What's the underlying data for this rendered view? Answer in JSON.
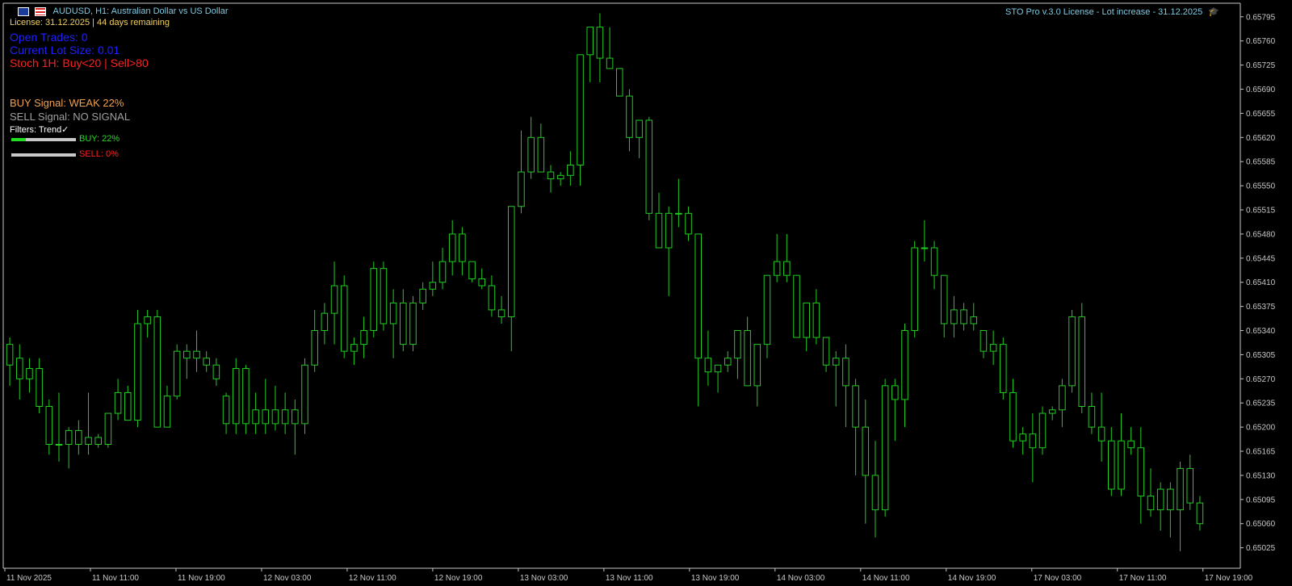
{
  "header": {
    "symbol_line": "AUDUSD, H1:  Australian Dollar vs US Dollar",
    "license_line": "License: 31.12.2025 | 44 days remaining",
    "right_title": "STO Pro v.3.0 License - Lot increase - 31.12.2025"
  },
  "panel": {
    "open_trades": "Open Trades: 0",
    "lot_size": "Current Lot Size: 0.01",
    "stoch": "Stoch 1H: Buy<20 | Sell>80",
    "buy_signal": "BUY Signal: WEAK 22%",
    "sell_signal": "SELL Signal: NO SIGNAL",
    "filters": "Filters: Trend✓",
    "buy_bar_label": "BUY: 22%",
    "sell_bar_label": "SELL: 0%",
    "buy_level": 0.22,
    "sell_level": 0.0
  },
  "colors": {
    "background": "#000000",
    "candle": "#22cc22",
    "axis": "#c8c8c8",
    "symbol_text": "#7fc8e0",
    "license_text": "#f0d060",
    "open_trades": "#2020ff",
    "stoch": "#ff2020",
    "buy_signal": "#f0a050",
    "sell_signal": "#a0a0a0",
    "buy_bar_label": "#22dd22",
    "sell_bar_label": "#ff2020"
  },
  "chart_data": {
    "type": "candlestick",
    "y_ticks": [
      "0.65795",
      "0.65760",
      "0.65725",
      "0.65690",
      "0.65655",
      "0.65620",
      "0.65585",
      "0.65550",
      "0.65515",
      "0.65480",
      "0.65445",
      "0.65410",
      "0.65375",
      "0.65340",
      "0.65305",
      "0.65270",
      "0.65235",
      "0.65200",
      "0.65165",
      "0.65130",
      "0.65095",
      "0.65060",
      "0.65025"
    ],
    "ylim": [
      0.65,
      0.6581
    ],
    "x_ticks": [
      "11 Nov 2025",
      "11 Nov 11:00",
      "11 Nov 19:00",
      "12 Nov 03:00",
      "12 Nov 11:00",
      "12 Nov 19:00",
      "13 Nov 03:00",
      "13 Nov 11:00",
      "13 Nov 19:00",
      "14 Nov 03:00",
      "14 Nov 11:00",
      "14 Nov 19:00",
      "17 Nov 03:00",
      "17 Nov 11:00",
      "17 Nov 19:00"
    ],
    "candles": [
      [
        0.6529,
        0.6533,
        0.6526,
        0.6532
      ],
      [
        0.653,
        0.6532,
        0.6524,
        0.6527
      ],
      [
        0.6527,
        0.653,
        0.6525,
        0.65285
      ],
      [
        0.65285,
        0.653,
        0.6522,
        0.6523
      ],
      [
        0.6523,
        0.6524,
        0.6516,
        0.65175
      ],
      [
        0.65175,
        0.6525,
        0.6515,
        0.65175
      ],
      [
        0.65175,
        0.652,
        0.6514,
        0.65195
      ],
      [
        0.65195,
        0.6521,
        0.6516,
        0.65175
      ],
      [
        0.65175,
        0.6525,
        0.6516,
        0.65185
      ],
      [
        0.65185,
        0.6519,
        0.6517,
        0.65175
      ],
      [
        0.65175,
        0.6522,
        0.6517,
        0.6522
      ],
      [
        0.6522,
        0.6527,
        0.6521,
        0.6525
      ],
      [
        0.6525,
        0.6526,
        0.6521,
        0.6521
      ],
      [
        0.6521,
        0.6537,
        0.652,
        0.6535
      ],
      [
        0.6535,
        0.6537,
        0.6533,
        0.6536
      ],
      [
        0.6536,
        0.6537,
        0.652,
        0.652
      ],
      [
        0.652,
        0.6526,
        0.652,
        0.65245
      ],
      [
        0.65245,
        0.6532,
        0.6524,
        0.6531
      ],
      [
        0.6531,
        0.6532,
        0.6527,
        0.653
      ],
      [
        0.653,
        0.6534,
        0.6528,
        0.6531
      ],
      [
        0.653,
        0.6531,
        0.6528,
        0.6529
      ],
      [
        0.6529,
        0.653,
        0.6526,
        0.6527
      ],
      [
        0.65245,
        0.6525,
        0.6519,
        0.65205
      ],
      [
        0.65205,
        0.653,
        0.6519,
        0.65285
      ],
      [
        0.65285,
        0.6529,
        0.6519,
        0.65205
      ],
      [
        0.65205,
        0.6525,
        0.6519,
        0.65225
      ],
      [
        0.65225,
        0.6527,
        0.6519,
        0.65205
      ],
      [
        0.65205,
        0.6526,
        0.65195,
        0.65225
      ],
      [
        0.65225,
        0.6525,
        0.6519,
        0.65205
      ],
      [
        0.65205,
        0.6524,
        0.6516,
        0.65225
      ],
      [
        0.65205,
        0.653,
        0.6519,
        0.6529
      ],
      [
        0.6529,
        0.6537,
        0.6528,
        0.6534
      ],
      [
        0.6534,
        0.6538,
        0.6532,
        0.65365
      ],
      [
        0.65365,
        0.6544,
        0.6532,
        0.65405
      ],
      [
        0.65405,
        0.6542,
        0.653,
        0.6531
      ],
      [
        0.6531,
        0.6533,
        0.6529,
        0.6532
      ],
      [
        0.6532,
        0.6536,
        0.653,
        0.6534
      ],
      [
        0.6534,
        0.6544,
        0.6533,
        0.6543
      ],
      [
        0.6543,
        0.6544,
        0.6534,
        0.6535
      ],
      [
        0.6535,
        0.654,
        0.653,
        0.6538
      ],
      [
        0.6538,
        0.654,
        0.6531,
        0.6532
      ],
      [
        0.6532,
        0.6539,
        0.6531,
        0.6538
      ],
      [
        0.6538,
        0.6541,
        0.6537,
        0.654
      ],
      [
        0.654,
        0.6544,
        0.6539,
        0.6541
      ],
      [
        0.6541,
        0.6546,
        0.654,
        0.6544
      ],
      [
        0.6544,
        0.655,
        0.6542,
        0.6548
      ],
      [
        0.6548,
        0.6549,
        0.6542,
        0.6544
      ],
      [
        0.6544,
        0.6544,
        0.6541,
        0.65415
      ],
      [
        0.65415,
        0.6543,
        0.654,
        0.65405
      ],
      [
        0.65405,
        0.6542,
        0.6536,
        0.6537
      ],
      [
        0.6537,
        0.6539,
        0.6535,
        0.6536
      ],
      [
        0.6536,
        0.6552,
        0.6531,
        0.6552
      ],
      [
        0.6552,
        0.6563,
        0.6551,
        0.6557
      ],
      [
        0.6557,
        0.6565,
        0.6556,
        0.6562
      ],
      [
        0.6562,
        0.6564,
        0.6557,
        0.6557
      ],
      [
        0.6557,
        0.6558,
        0.6554,
        0.6556
      ],
      [
        0.6556,
        0.6557,
        0.6555,
        0.65565
      ],
      [
        0.65565,
        0.656,
        0.6555,
        0.6558
      ],
      [
        0.6558,
        0.6562,
        0.6555,
        0.6574
      ],
      [
        0.6574,
        0.6578,
        0.657,
        0.6578
      ],
      [
        0.6578,
        0.658,
        0.657,
        0.65735
      ],
      [
        0.65735,
        0.6578,
        0.6572,
        0.6572
      ],
      [
        0.6572,
        0.6572,
        0.6568,
        0.6568
      ],
      [
        0.6568,
        0.6569,
        0.656,
        0.6562
      ],
      [
        0.6562,
        0.6564,
        0.6559,
        0.65645
      ],
      [
        0.65645,
        0.6565,
        0.655,
        0.6551
      ],
      [
        0.6551,
        0.6554,
        0.6546,
        0.6546
      ],
      [
        0.6546,
        0.6552,
        0.6539,
        0.6551
      ],
      [
        0.6551,
        0.6556,
        0.6549,
        0.6551
      ],
      [
        0.6551,
        0.6552,
        0.6547,
        0.6548
      ],
      [
        0.6548,
        0.6548,
        0.6523,
        0.653
      ],
      [
        0.653,
        0.6534,
        0.6526,
        0.6528
      ],
      [
        0.6528,
        0.6529,
        0.6525,
        0.6529
      ],
      [
        0.6529,
        0.6531,
        0.6528,
        0.653
      ],
      [
        0.653,
        0.6534,
        0.6527,
        0.6534
      ],
      [
        0.6534,
        0.6536,
        0.6526,
        0.6526
      ],
      [
        0.6526,
        0.6532,
        0.6523,
        0.6532
      ],
      [
        0.6532,
        0.6542,
        0.653,
        0.6542
      ],
      [
        0.6542,
        0.6548,
        0.6541,
        0.6544
      ],
      [
        0.6544,
        0.6548,
        0.6541,
        0.6542
      ],
      [
        0.6542,
        0.6541,
        0.6533,
        0.6533
      ],
      [
        0.6533,
        0.6538,
        0.6531,
        0.6538
      ],
      [
        0.6538,
        0.654,
        0.6532,
        0.6533
      ],
      [
        0.6533,
        0.6533,
        0.6528,
        0.6529
      ],
      [
        0.6529,
        0.6531,
        0.6523,
        0.653
      ],
      [
        0.653,
        0.6532,
        0.652,
        0.6526
      ],
      [
        0.6526,
        0.6527,
        0.6513,
        0.652
      ],
      [
        0.652,
        0.6524,
        0.6506,
        0.6513
      ],
      [
        0.6513,
        0.6518,
        0.6504,
        0.6508
      ],
      [
        0.6508,
        0.6527,
        0.6507,
        0.6526
      ],
      [
        0.6526,
        0.6527,
        0.6518,
        0.6524
      ],
      [
        0.6524,
        0.6535,
        0.652,
        0.6534
      ],
      [
        0.6534,
        0.6547,
        0.6533,
        0.6546
      ],
      [
        0.6546,
        0.655,
        0.6544,
        0.6546
      ],
      [
        0.6546,
        0.6547,
        0.654,
        0.6542
      ],
      [
        0.6542,
        0.6542,
        0.6533,
        0.6535
      ],
      [
        0.6535,
        0.6539,
        0.6533,
        0.6537
      ],
      [
        0.6537,
        0.6538,
        0.6534,
        0.6535
      ],
      [
        0.6535,
        0.6538,
        0.6534,
        0.6536
      ],
      [
        0.6534,
        0.6534,
        0.653,
        0.6531
      ],
      [
        0.6531,
        0.6534,
        0.6529,
        0.6532
      ],
      [
        0.6532,
        0.6533,
        0.6524,
        0.6525
      ],
      [
        0.6525,
        0.6527,
        0.6517,
        0.6518
      ],
      [
        0.6518,
        0.652,
        0.6516,
        0.6519
      ],
      [
        0.6519,
        0.6522,
        0.6512,
        0.6517
      ],
      [
        0.6517,
        0.6523,
        0.6516,
        0.6522
      ],
      [
        0.6522,
        0.6523,
        0.6521,
        0.65225
      ],
      [
        0.65225,
        0.6527,
        0.652,
        0.6526
      ],
      [
        0.6526,
        0.6537,
        0.6525,
        0.6536
      ],
      [
        0.6536,
        0.6538,
        0.6522,
        0.6523
      ],
      [
        0.6523,
        0.6525,
        0.6519,
        0.652
      ],
      [
        0.652,
        0.6525,
        0.6515,
        0.6518
      ],
      [
        0.6518,
        0.652,
        0.651,
        0.6511
      ],
      [
        0.6511,
        0.6522,
        0.651,
        0.6518
      ],
      [
        0.6518,
        0.652,
        0.6516,
        0.6517
      ],
      [
        0.6517,
        0.652,
        0.6506,
        0.651
      ],
      [
        0.651,
        0.6514,
        0.6507,
        0.6508
      ],
      [
        0.6508,
        0.6512,
        0.6505,
        0.6511
      ],
      [
        0.6511,
        0.6512,
        0.6504,
        0.6508
      ],
      [
        0.6508,
        0.6515,
        0.6502,
        0.6514
      ],
      [
        0.6514,
        0.6516,
        0.6508,
        0.6509
      ],
      [
        0.6509,
        0.651,
        0.6505,
        0.6506
      ]
    ]
  }
}
